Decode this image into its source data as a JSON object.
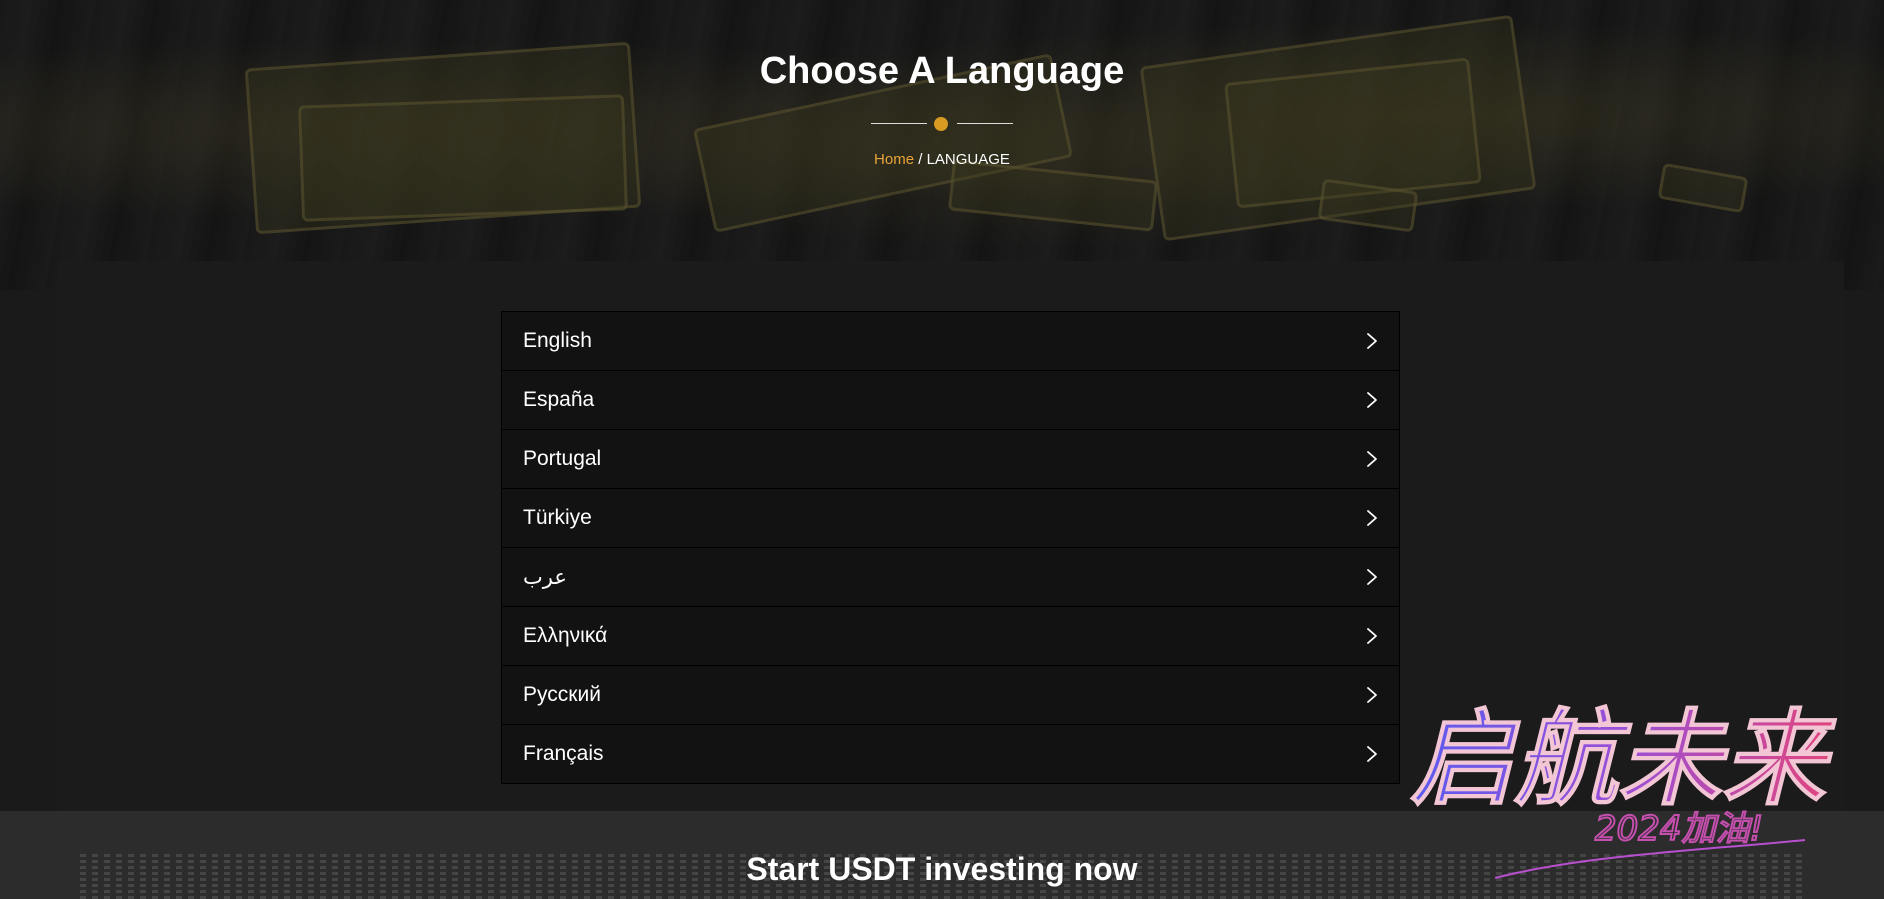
{
  "hero": {
    "title": "Choose A Language",
    "breadcrumb": {
      "home": "Home",
      "separator": " / ",
      "current": "LANGUAGE"
    }
  },
  "languages": [
    {
      "label": "English",
      "icon": "chevron-right-icon"
    },
    {
      "label": "España",
      "icon": "chevron-right-icon"
    },
    {
      "label": "Portugal",
      "icon": "chevron-right-icon"
    },
    {
      "label": "Türkiye",
      "icon": "chevron-right-icon"
    },
    {
      "label": "عرب",
      "icon": "chevron-right-icon"
    },
    {
      "label": "Ελληνικά",
      "icon": "chevron-right-icon"
    },
    {
      "label": "Русский",
      "icon": "chevron-right-icon"
    },
    {
      "label": "Français",
      "icon": "chevron-right-icon"
    }
  ],
  "footer": {
    "cta_title": "Start USDT investing now"
  },
  "overlay": {
    "calligraphy_text": "启航未来",
    "calligraphy_sub": "2024加油!"
  },
  "colors": {
    "accent": "#d99a22",
    "breadcrumb_home": "#e8a33a",
    "background": "#1a1a1a",
    "list_item_bg": "#121212"
  }
}
